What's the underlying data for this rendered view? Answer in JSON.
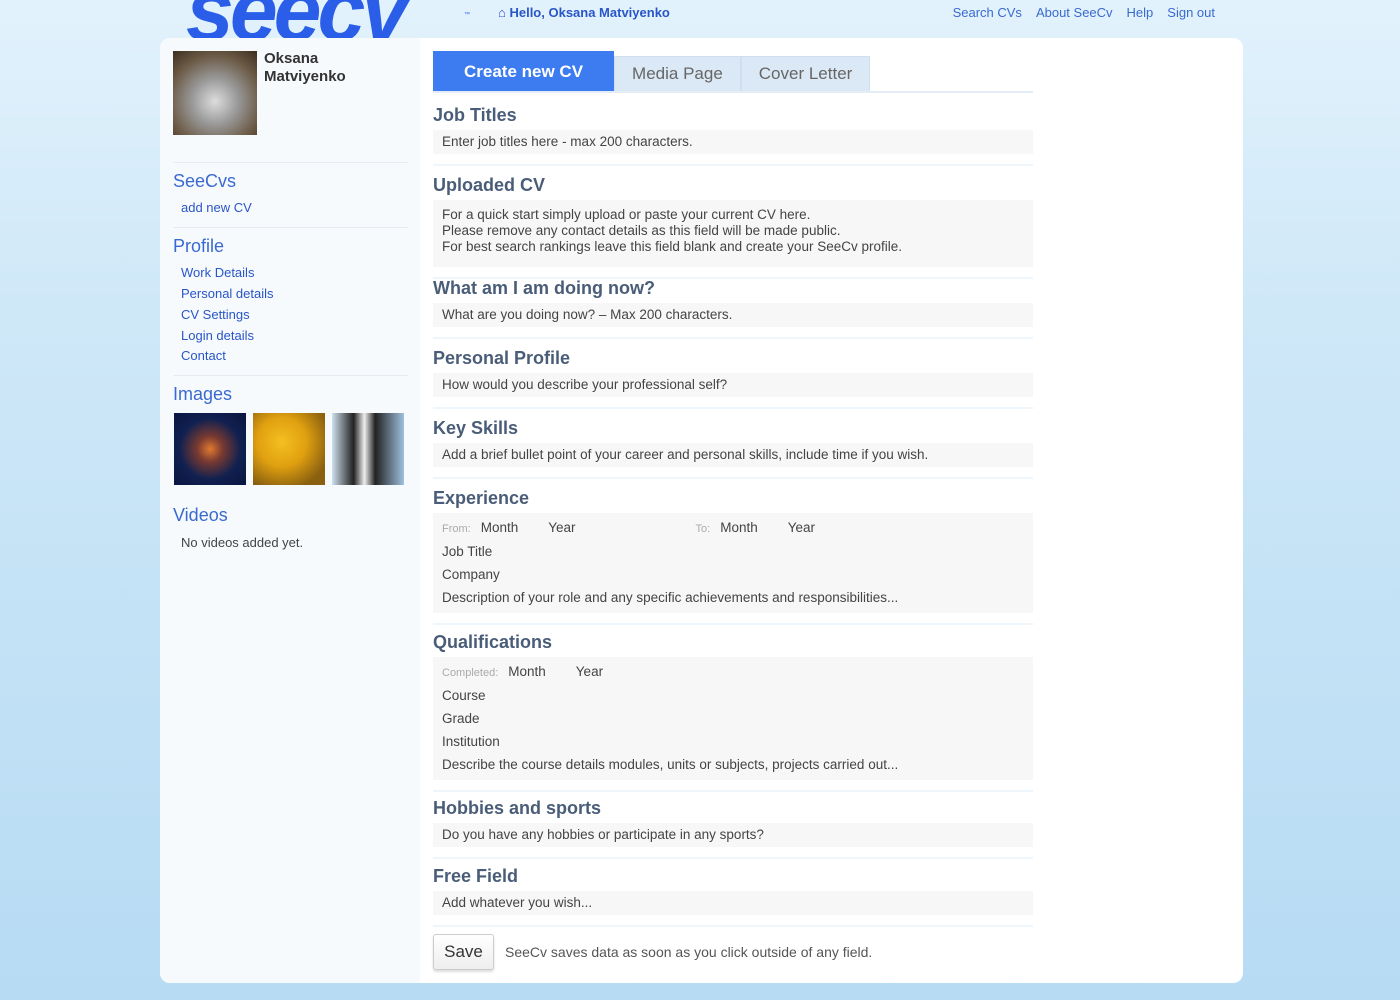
{
  "header": {
    "logo": "seecv",
    "tm": "™",
    "hello": "Hello, Oksana Matviyenko",
    "nav": [
      "Search CVs",
      "About SeeCv",
      "Help",
      "Sign out"
    ]
  },
  "sidebar": {
    "user_name": "Oksana Matviyenko",
    "seecvs": {
      "title": "SeeCvs",
      "items": [
        "add new CV"
      ]
    },
    "profile": {
      "title": "Profile",
      "items": [
        "Work Details",
        "Personal details",
        "CV Settings",
        "Login details",
        "Contact"
      ]
    },
    "images": {
      "title": "Images"
    },
    "videos": {
      "title": "Videos",
      "empty": "No videos added yet."
    }
  },
  "tabs": [
    "Create new CV",
    "Media Page",
    "Cover Letter"
  ],
  "sections": {
    "job_titles": {
      "title": "Job Titles",
      "placeholder": "Enter job titles here - max 200 characters."
    },
    "uploaded_cv": {
      "title": "Uploaded CV",
      "lines": [
        "For a quick start simply upload or paste your current CV here.",
        "Please remove any contact details as this field will be made public.",
        "For best search rankings leave this field blank and create your SeeCv profile."
      ]
    },
    "doing_now": {
      "title": "What am I am doing now?",
      "placeholder": "What are you doing now? – Max 200 characters."
    },
    "personal_profile": {
      "title": "Personal Profile",
      "placeholder": "How would you describe your professional self?"
    },
    "key_skills": {
      "title": "Key Skills",
      "placeholder": "Add a brief bullet point of your career and personal skills, include time if you wish."
    },
    "experience": {
      "title": "Experience",
      "from": "From:",
      "to": "To:",
      "month": "Month",
      "year": "Year",
      "job_title": "Job Title",
      "company": "Company",
      "description": "Description of your role and any specific achievements and responsibilities..."
    },
    "qualifications": {
      "title": "Qualifications",
      "completed": "Completed:",
      "month": "Month",
      "year": "Year",
      "course": "Course",
      "grade": "Grade",
      "institution": "Institution",
      "description": "Describe the course details modules, units or subjects, projects carried out..."
    },
    "hobbies": {
      "title": "Hobbies and sports",
      "placeholder": "Do you have any hobbies or participate in any sports?"
    },
    "free_field": {
      "title": "Free Field",
      "placeholder": "Add whatever you wish..."
    }
  },
  "save": {
    "label": "Save",
    "note": "SeeCv saves data as soon as you click outside of any field."
  },
  "colors": {
    "accent": "#3d7bf0",
    "link": "#2a55c8",
    "logo": "#2a5ee8"
  }
}
